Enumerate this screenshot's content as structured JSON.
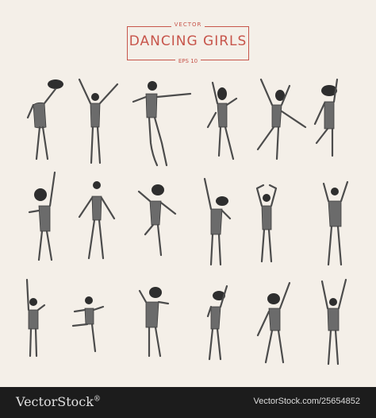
{
  "header": {
    "kicker": "VECTOR",
    "title": "DANCING GIRLS",
    "subtitle": "EPS 10"
  },
  "footer": {
    "logo_part1": "VectorStock",
    "logo_suffix": "®",
    "image_id": "VectorStock.com/25654852"
  },
  "colors": {
    "background": "#f4efe8",
    "accent": "#c7554b",
    "sketch": "#4c4c4c",
    "footer_bg": "#1c1c1c"
  }
}
